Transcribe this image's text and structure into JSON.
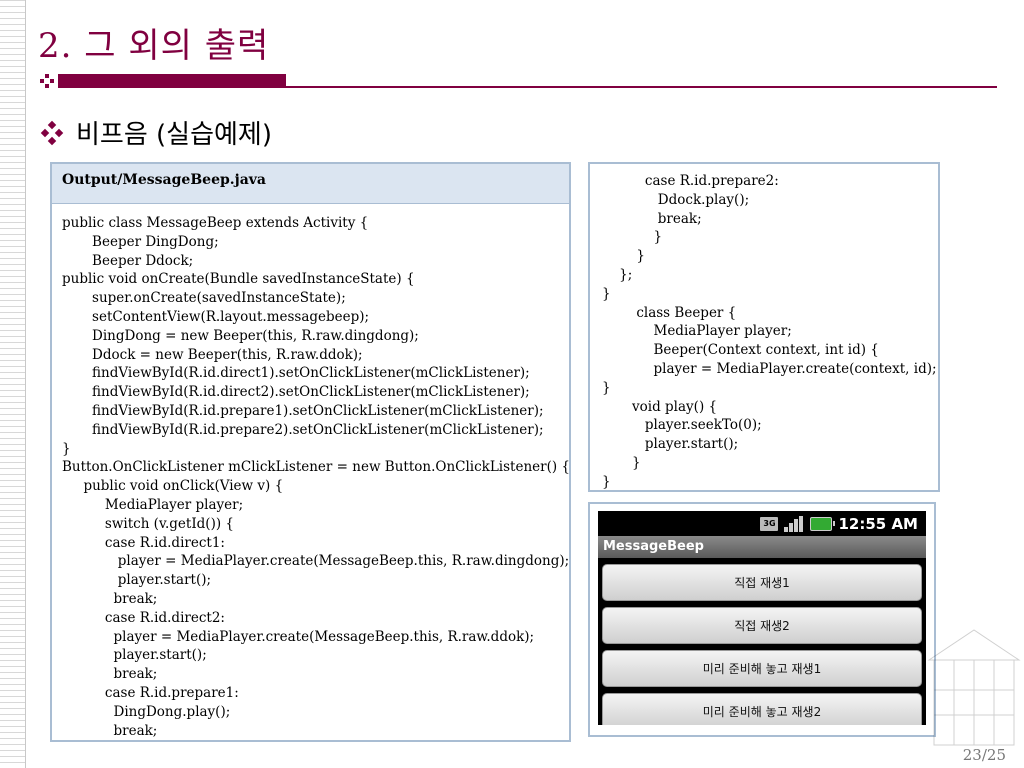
{
  "slide": {
    "title": "2. 그 외의 출력",
    "bullet": "비프음 (실습예제)",
    "page_number": "23/25"
  },
  "code_panel": {
    "filename": "Output/MessageBeep.java",
    "lines": [
      "public class MessageBeep extends Activity {",
      "       Beeper DingDong;",
      "       Beeper Ddock;",
      "public void onCreate(Bundle savedInstanceState) {",
      "       super.onCreate(savedInstanceState);",
      "       setContentView(R.layout.messagebeep);",
      "       DingDong = new Beeper(this, R.raw.dingdong);",
      "       Ddock = new Beeper(this, R.raw.ddok);",
      "       findViewById(R.id.direct1).setOnClickListener(mClickListener);",
      "       findViewById(R.id.direct2).setOnClickListener(mClickListener);",
      "       findViewById(R.id.prepare1).setOnClickListener(mClickListener);",
      "       findViewById(R.id.prepare2).setOnClickListener(mClickListener);",
      "}",
      "Button.OnClickListener mClickListener = new Button.OnClickListener() {",
      "     public void onClick(View v) {",
      "          MediaPlayer player;",
      "          switch (v.getId()) {",
      "          case R.id.direct1:",
      "             player = MediaPlayer.create(MessageBeep.this, R.raw.dingdong);",
      "             player.start();",
      "            break;",
      "          case R.id.direct2:",
      "            player = MediaPlayer.create(MessageBeep.this, R.raw.ddok);",
      "            player.start();",
      "            break;",
      "          case R.id.prepare1:",
      "            DingDong.play();",
      "            break;"
    ]
  },
  "code_panel_right": {
    "lines": [
      "          case R.id.prepare2:",
      "             Ddock.play();",
      "             break;",
      "            }",
      "        }",
      "    };",
      "}",
      "        class Beeper {",
      "            MediaPlayer player;",
      "            Beeper(Context context, int id) {",
      "            player = MediaPlayer.create(context, id);",
      "}",
      "       void play() {",
      "          player.seekTo(0);",
      "          player.start();",
      "       }",
      "}"
    ]
  },
  "phone": {
    "status_network": "3G",
    "status_time": "12:55 AM",
    "app_title": "MessageBeep",
    "buttons": [
      "직접 재생1",
      "직접 재생2",
      "미리 준비해 놓고 재생1",
      "미리 준비해 놓고 재생2"
    ]
  },
  "colors": {
    "accent": "#800040",
    "panel_border": "#a9bdd3",
    "panel_header": "#dbe5f1"
  }
}
